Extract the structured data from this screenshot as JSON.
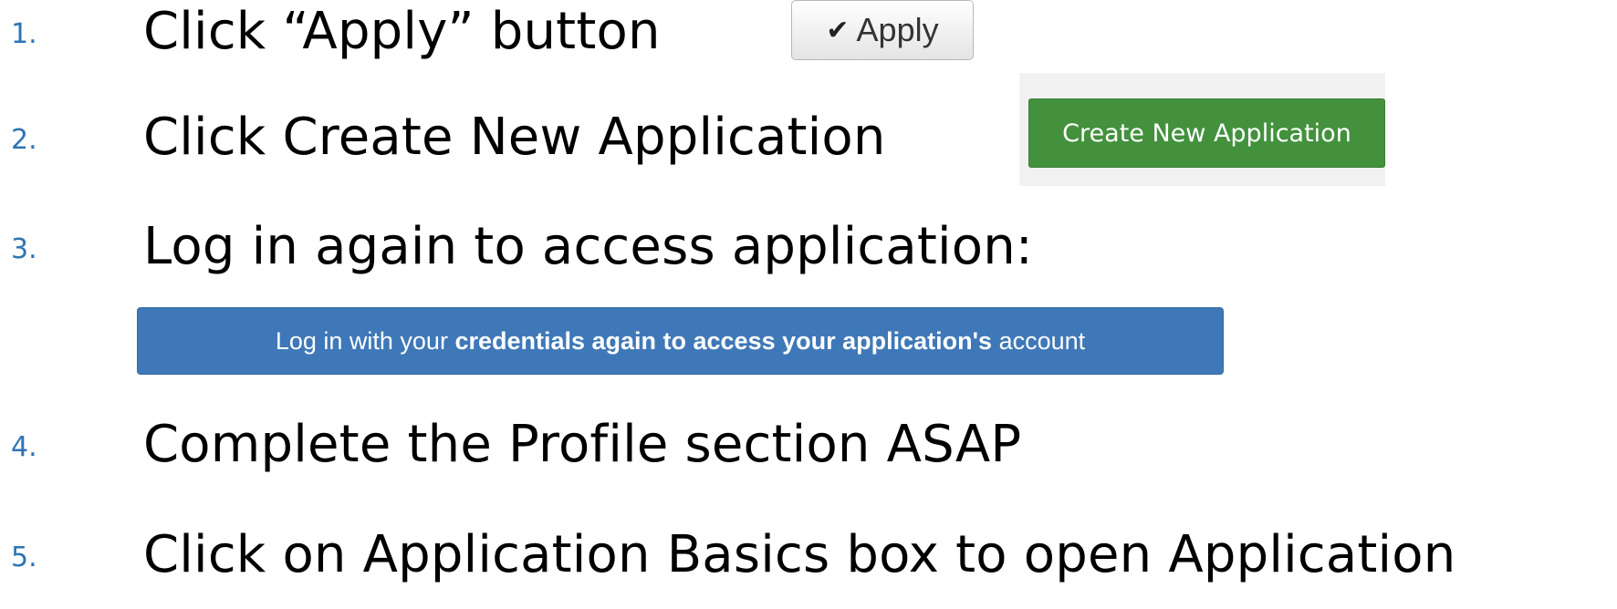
{
  "steps": [
    {
      "number": "1.",
      "text": "Click “Apply” button"
    },
    {
      "number": "2.",
      "text": "Click Create New Application"
    },
    {
      "number": "3.",
      "text": "Log in again to access application:"
    },
    {
      "number": "4.",
      "text": "Complete the Profile section ASAP"
    },
    {
      "number": "5.",
      "text": "Click on Application Basics box to open Application"
    }
  ],
  "apply_button": {
    "icon": "check-icon",
    "label": "Apply"
  },
  "create_new_application_button": {
    "label": "Create New Application",
    "color": "#43913d"
  },
  "login_banner": {
    "part1": "Log in with your ",
    "part2_bold": "credentials again to access your application's",
    "part3": " account",
    "color": "#3f78b8"
  },
  "colors": {
    "step_number": "#2e74b5",
    "step_text": "#000000"
  }
}
